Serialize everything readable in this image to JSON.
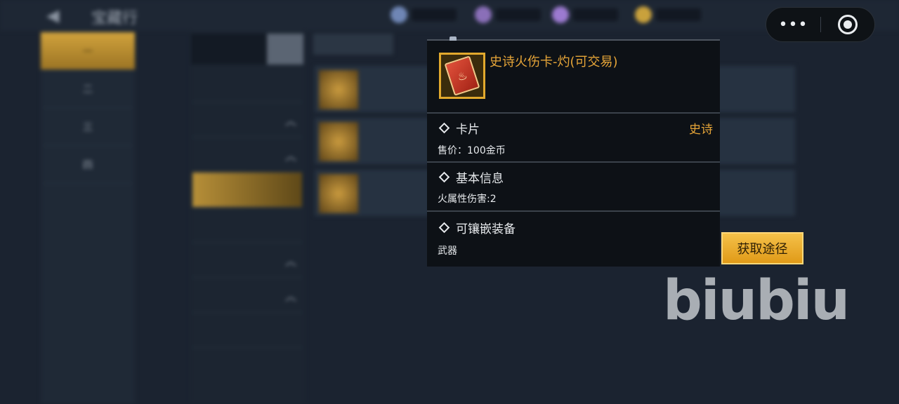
{
  "background": {
    "top_title": "宝藏行",
    "left_nav": [
      "一",
      "二",
      "三",
      "四"
    ],
    "search": {
      "placeholder": "",
      "button": ""
    },
    "categories": [
      {
        "label": "",
        "expand": false
      },
      {
        "label": "",
        "expand": true
      },
      {
        "label": "",
        "expand": true
      },
      {
        "label": "",
        "expand": false,
        "active": true
      },
      {
        "label": "",
        "expand": false
      },
      {
        "label": "",
        "expand": true
      },
      {
        "label": "",
        "expand": true
      },
      {
        "label": "",
        "expand": false
      }
    ],
    "list_tag": "",
    "rows": [
      {
        "name": "",
        "sub": ""
      },
      {
        "name": "",
        "sub": ""
      },
      {
        "name": "",
        "sub": ""
      }
    ]
  },
  "capsule": {
    "more_icon": "more-dots-icon",
    "close_icon": "target-ring-icon"
  },
  "item": {
    "name": "史诗火伤卡-灼(可交易)",
    "icon": "fire-card-icon",
    "frame_color": "#e2a92d"
  },
  "sections": {
    "card": {
      "title": "卡片",
      "rarity": "史诗",
      "price": "售价：100金币"
    },
    "basic": {
      "title": "基本信息",
      "attr": "火属性伤害:2"
    },
    "equip": {
      "title": "可镶嵌装备",
      "value": "武器"
    }
  },
  "acquire_button": {
    "label": "获取途径"
  },
  "watermark": "biubiu",
  "colors": {
    "accent": "#e6a538",
    "panel_bg": "#0d1116",
    "button": "#f0b232"
  }
}
